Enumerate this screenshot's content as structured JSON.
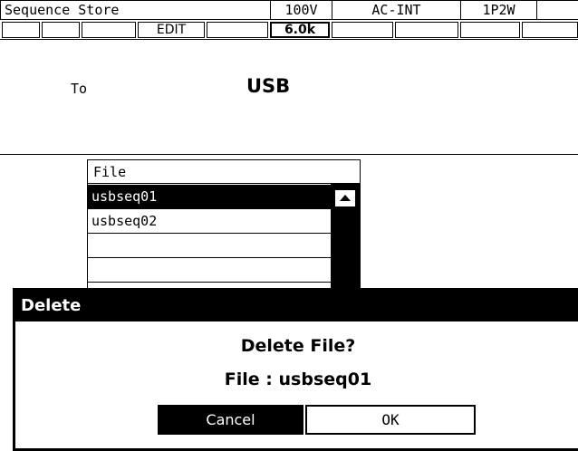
{
  "status": {
    "screen_title": "Sequence Store",
    "voltage_range": "100V",
    "source": "AC-INT",
    "wiring": "1P2W",
    "mode_key": "EDIT",
    "value_key": "6.0k"
  },
  "destination": {
    "label": "To",
    "value": "USB"
  },
  "file_list": {
    "header": "File",
    "items": [
      "usbseq01",
      "usbseq02",
      "",
      ""
    ],
    "selected_index": 0
  },
  "dialog": {
    "title": "Delete",
    "question": "Delete File?",
    "file_line": "File : usbseq01",
    "cancel_label": "Cancel",
    "ok_label": "OK"
  },
  "icons": {
    "scroll_up": "triangle-up-icon"
  }
}
